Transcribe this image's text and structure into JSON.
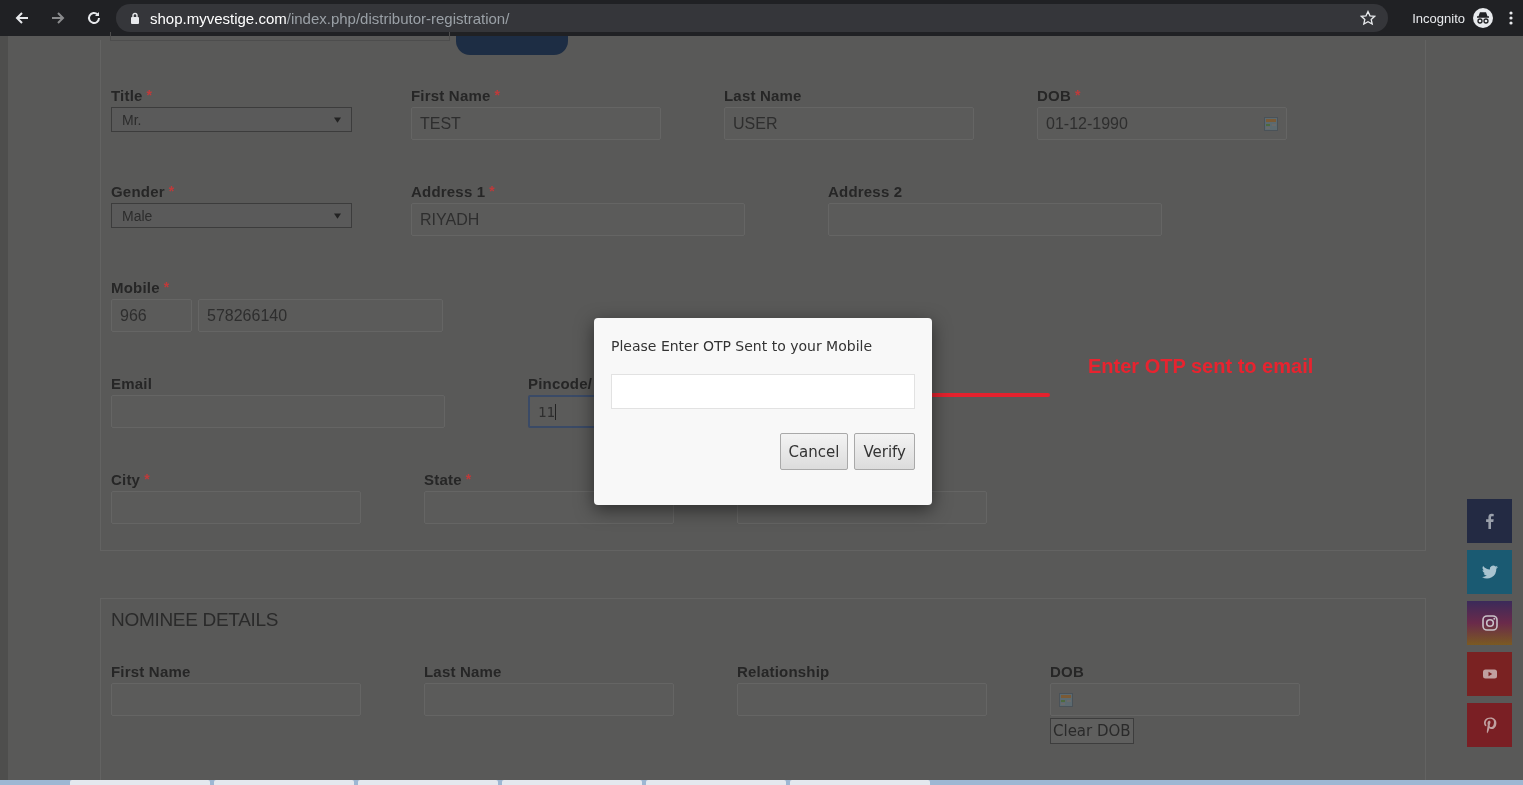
{
  "browser": {
    "url_host": "shop.myvestige.com",
    "url_path": "/index.php/distributor-registration/",
    "profile_label": "Incognito"
  },
  "form": {
    "rows": [
      {
        "fields": [
          {
            "label": "Title",
            "mark": "*",
            "kind": "select",
            "value": "Mr."
          },
          {
            "label": "First Name",
            "mark": "*",
            "kind": "text",
            "value": "TEST"
          },
          {
            "label": "Last Name",
            "kind": "text",
            "value": "USER"
          },
          {
            "label": "DOB",
            "mark": "*",
            "kind": "date",
            "value": "01-12-1990"
          }
        ]
      },
      {
        "fields": [
          {
            "label": "Gender",
            "mark": "*",
            "kind": "select",
            "value": "Male"
          },
          {
            "label": "Address 1",
            "mark": "*",
            "kind": "text",
            "value": "RIYADH"
          },
          {
            "label": "Address 2",
            "kind": "text"
          }
        ]
      },
      {
        "fields": [
          {
            "label": "Mobile",
            "mark": "*",
            "kind": "phone",
            "value": "966",
            "value2": "578266140"
          }
        ]
      },
      {
        "fields": [
          {
            "label": "Email",
            "kind": "text"
          },
          {
            "label": "Pincode/",
            "kind": "focused",
            "value": "11"
          }
        ]
      },
      {
        "fields": [
          {
            "label": "City",
            "mark": "*",
            "kind": "text"
          },
          {
            "label": "State",
            "mark": "*",
            "kind": "text"
          },
          {
            "kind": "text"
          }
        ]
      }
    ]
  },
  "nominee": {
    "heading": "NOMINEE DETAILS",
    "fields": [
      {
        "label": "First Name",
        "kind": "text"
      },
      {
        "label": "Last Name",
        "kind": "text"
      },
      {
        "label": "Relationship",
        "kind": "text"
      },
      {
        "label": "DOB",
        "kind": "date"
      }
    ],
    "clear_button": "Clear DOB"
  },
  "modal": {
    "message": "Please Enter OTP Sent to your Mobile",
    "buttons": [
      "Cancel",
      "Verify"
    ]
  },
  "annotation": {
    "text": "Enter OTP sent to email"
  },
  "social": [
    {
      "kind": "facebook"
    },
    {
      "kind": "twitter"
    },
    {
      "kind": "instagram"
    },
    {
      "kind": "youtube"
    },
    {
      "kind": "pinterest"
    }
  ]
}
